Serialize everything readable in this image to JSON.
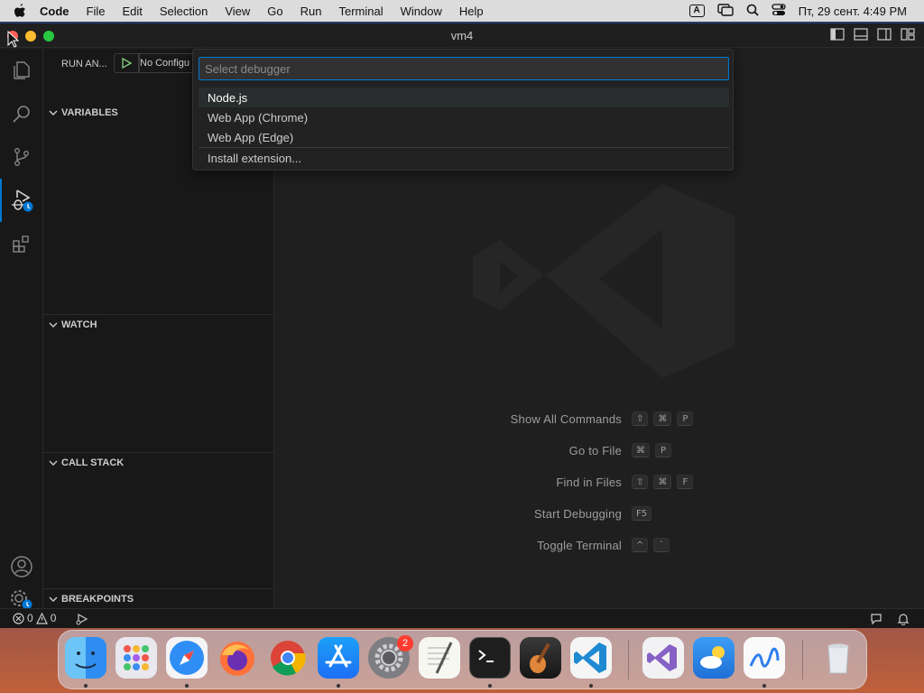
{
  "menubar": {
    "app_name": "Code",
    "items": [
      "File",
      "Edit",
      "Selection",
      "View",
      "Go",
      "Run",
      "Terminal",
      "Window",
      "Help"
    ],
    "input_indicator": "A",
    "datetime": "Пт, 29 сент.  4:49 PM"
  },
  "window": {
    "title": "vm4"
  },
  "sidebar": {
    "header": "RUN AN...",
    "config_select": "No Configu",
    "sections": {
      "variables": "VARIABLES",
      "watch": "WATCH",
      "call_stack": "CALL STACK",
      "breakpoints": "BREAKPOINTS"
    }
  },
  "quickpick": {
    "placeholder": "Select debugger",
    "items": [
      "Node.js",
      "Web App (Chrome)",
      "Web App (Edge)",
      "Install extension..."
    ]
  },
  "shortcuts": [
    {
      "label": "Show All Commands",
      "keys": [
        "⇧",
        "⌘",
        "P"
      ]
    },
    {
      "label": "Go to File",
      "keys": [
        "⌘",
        "P"
      ]
    },
    {
      "label": "Find in Files",
      "keys": [
        "⇧",
        "⌘",
        "F"
      ]
    },
    {
      "label": "Start Debugging",
      "keys": [
        "F5"
      ]
    },
    {
      "label": "Toggle Terminal",
      "keys": [
        "^",
        "`"
      ]
    }
  ],
  "statusbar": {
    "errors": "0",
    "warnings": "0"
  },
  "dock": {
    "settings_badge": "2"
  },
  "colors": {
    "accent": "#0078d4",
    "editor_bg": "#1f1f1f",
    "sidebar_bg": "#181818"
  }
}
